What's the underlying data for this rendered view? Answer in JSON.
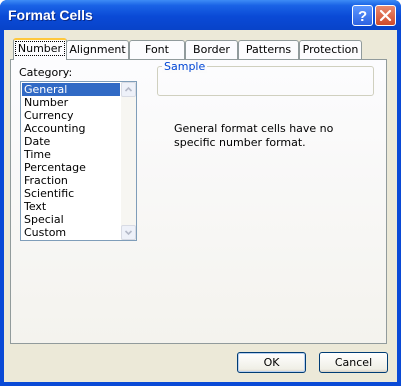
{
  "window": {
    "title": "Format Cells"
  },
  "tabs": [
    {
      "label": "Number",
      "active": true
    },
    {
      "label": "Alignment",
      "active": false
    },
    {
      "label": "Font",
      "active": false
    },
    {
      "label": "Border",
      "active": false
    },
    {
      "label": "Patterns",
      "active": false
    },
    {
      "label": "Protection",
      "active": false
    }
  ],
  "number_tab": {
    "category_label": "Category:",
    "categories": [
      "General",
      "Number",
      "Currency",
      "Accounting",
      "Date",
      "Time",
      "Percentage",
      "Fraction",
      "Scientific",
      "Text",
      "Special",
      "Custom"
    ],
    "selected_category": "General",
    "sample_label": "Sample",
    "description": "General format cells have no specific number format."
  },
  "buttons": {
    "ok": "OK",
    "cancel": "Cancel"
  },
  "icons": [
    "help-icon",
    "close-icon",
    "scroll-up-icon",
    "scroll-down-icon"
  ],
  "colors": {
    "title_bar": "#0a4ad6",
    "client_bg": "#ece9d8",
    "selection": "#316ac5",
    "active_tab_accent": "#ffc83c",
    "sample_legend": "#0046d5"
  }
}
